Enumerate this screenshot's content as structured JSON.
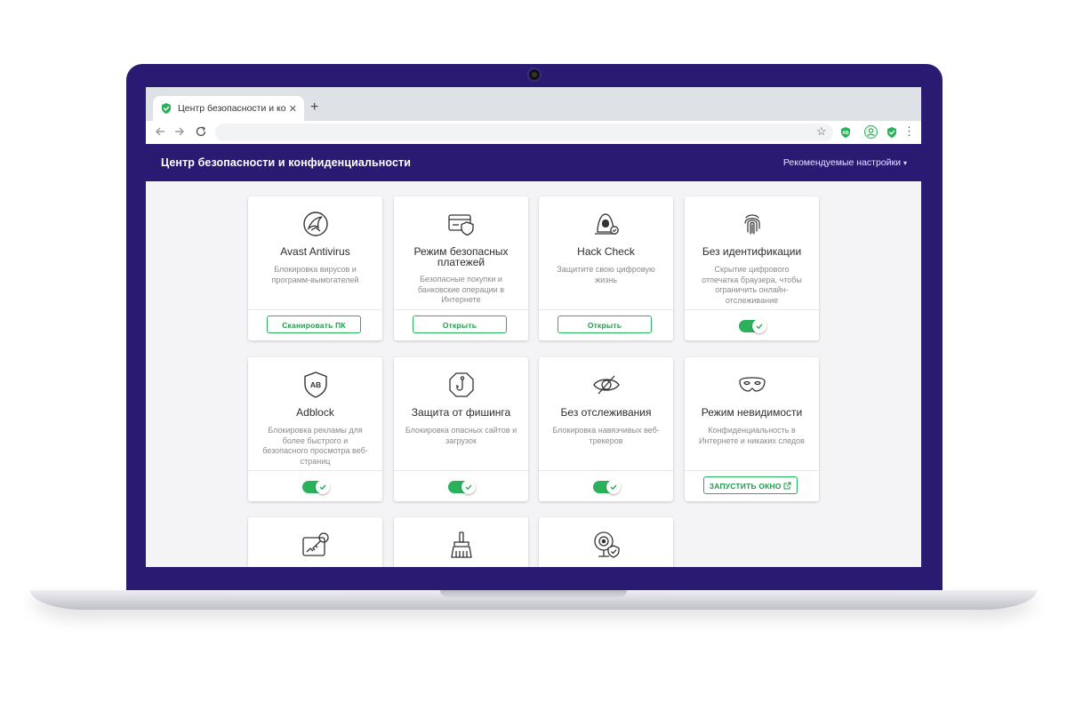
{
  "browser": {
    "tab_title": "Центр безопасности и конфид...",
    "tab_close": "✕",
    "new_tab": "+",
    "extension_badge": "AB"
  },
  "app": {
    "title": "Центр безопасности и конфиденциальности",
    "settings_label": "Рекомендуемые настройки",
    "settings_caret": "▾"
  },
  "cards": [
    {
      "title": "Avast Antivirus",
      "desc": "Блокировка вирусов и программ-вымогателей",
      "action": "Сканировать ПК",
      "icon": "avast-logo-icon"
    },
    {
      "title": "Режим безопасных платежей",
      "desc": "Безопасные покупки и банковские операции в Интернете",
      "action": "Открыть",
      "icon": "secure-card-icon"
    },
    {
      "title": "Hack Check",
      "desc": "Защитите свою цифровую жизнь",
      "action": "Открыть",
      "icon": "hacker-icon"
    },
    {
      "title": "Без идентификации",
      "desc": "Скрытие цифрового отпечатка браузера, чтобы ограничить онлайн-отслеживание",
      "toggle_on": true,
      "icon": "fingerprint-icon"
    },
    {
      "title": "Adblock",
      "desc": "Блокировка рекламы для более быстрого и безопасного просмотра веб-страниц",
      "toggle_on": true,
      "icon": "adblock-shield-icon",
      "icon_text": "AB"
    },
    {
      "title": "Защита от фишинга",
      "desc": "Блокировка опасных сайтов и загрузок",
      "toggle_on": true,
      "icon": "fishhook-icon"
    },
    {
      "title": "Без отслеживания",
      "desc": "Блокировка навязчивых веб-трекеров",
      "toggle_on": true,
      "icon": "eye-off-icon"
    },
    {
      "title": "Режим невидимости",
      "desc": "Конфиденциальность в Интернете и никаких следов",
      "action": "ЗАПУСТИТЬ ОКНО",
      "action_icon": "external-link-icon",
      "icon": "mask-icon"
    },
    {
      "icon": "password-key-icon"
    },
    {
      "icon": "broom-icon"
    },
    {
      "icon": "webcam-shield-icon"
    }
  ],
  "colors": {
    "brand": "#2a1a72",
    "accent_green": "#2bb15a"
  }
}
